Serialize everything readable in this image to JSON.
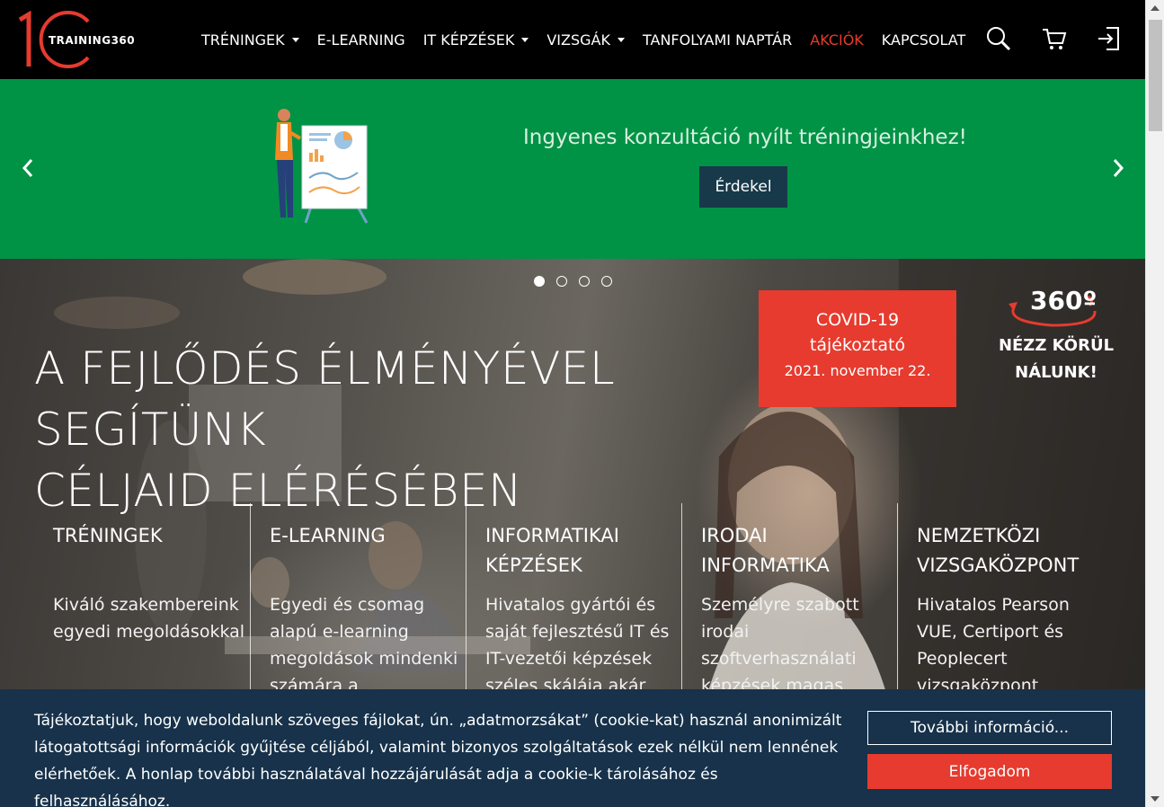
{
  "header": {
    "logo_text": "TRAINING360",
    "nav": [
      {
        "label": "TRÉNINGEK",
        "has_dropdown": true
      },
      {
        "label": "E-LEARNING",
        "has_dropdown": false
      },
      {
        "label": "IT KÉPZÉSEK",
        "has_dropdown": true
      },
      {
        "label": "VIZSGÁK",
        "has_dropdown": true
      },
      {
        "label": "TANFOLYAMI NAPTÁR",
        "has_dropdown": false
      },
      {
        "label": "AKCIÓK",
        "has_dropdown": false
      },
      {
        "label": "KAPCSOLAT",
        "has_dropdown": false
      }
    ],
    "icons": [
      "search-icon",
      "cart-icon",
      "login-icon"
    ]
  },
  "promo": {
    "text": "Ingyenes konzultáció nyílt tréningjeinkhez!",
    "button": "Érdekel"
  },
  "hero": {
    "slides_total": 4,
    "active_slide": 1,
    "title_line1": "A FEJLŐDÉS ÉLMÉNYÉVEL SEGÍTÜNK",
    "title_line2": "CÉLJAID ELÉRÉSÉBEN",
    "covid": {
      "line1": "COVID-19",
      "line2": "tájékoztató",
      "date": "2021. november 22."
    },
    "tour": {
      "number": "360º",
      "line1": "NÉZZ KÖRÜL",
      "line2": "NÁLUNK!"
    },
    "columns": [
      {
        "title": "TRÉNINGEK",
        "text": "Kiváló szakembereink egyedi megoldásokkal"
      },
      {
        "title": "E-LEARNING",
        "text": "Egyedi és csomag alapú e-learning megoldások mindenki számára a"
      },
      {
        "title": "INFORMATIKAI KÉPZÉSEK",
        "text": "Hivatalos gyártói és saját fejlesztésű IT és IT-vezetői képzések széles skálája akár"
      },
      {
        "title": "IRODAI INFORMATIKA",
        "text": "Személyre szabott irodai szoftverhasználati képzések magas"
      },
      {
        "title": "NEMZETKÖZI VIZSGAKÖZPONT",
        "text": "Hivatalos Pearson VUE, Certiport és Peoplecert vizsgaközpont"
      }
    ]
  },
  "cookie": {
    "text": "Tájékoztatjuk, hogy weboldalunk szöveges fájlokat, ún. „adatmorzsákat” (cookie-kat) használ anonimizált látogatottsági információk gyűjtése céljából, valamint bizonyos szolgáltatások ezek nélkül nem lennének elérhetőek. A honlap további használatával hozzájárulását adja a cookie-k tárolásához és felhasználásához.",
    "more_button": "További információ...",
    "accept_button": "Elfogadom"
  },
  "colors": {
    "accent": "#e63b2e",
    "promo_green": "#009245",
    "dark_teal": "#17394a",
    "cookie_bg": "#17324a"
  }
}
